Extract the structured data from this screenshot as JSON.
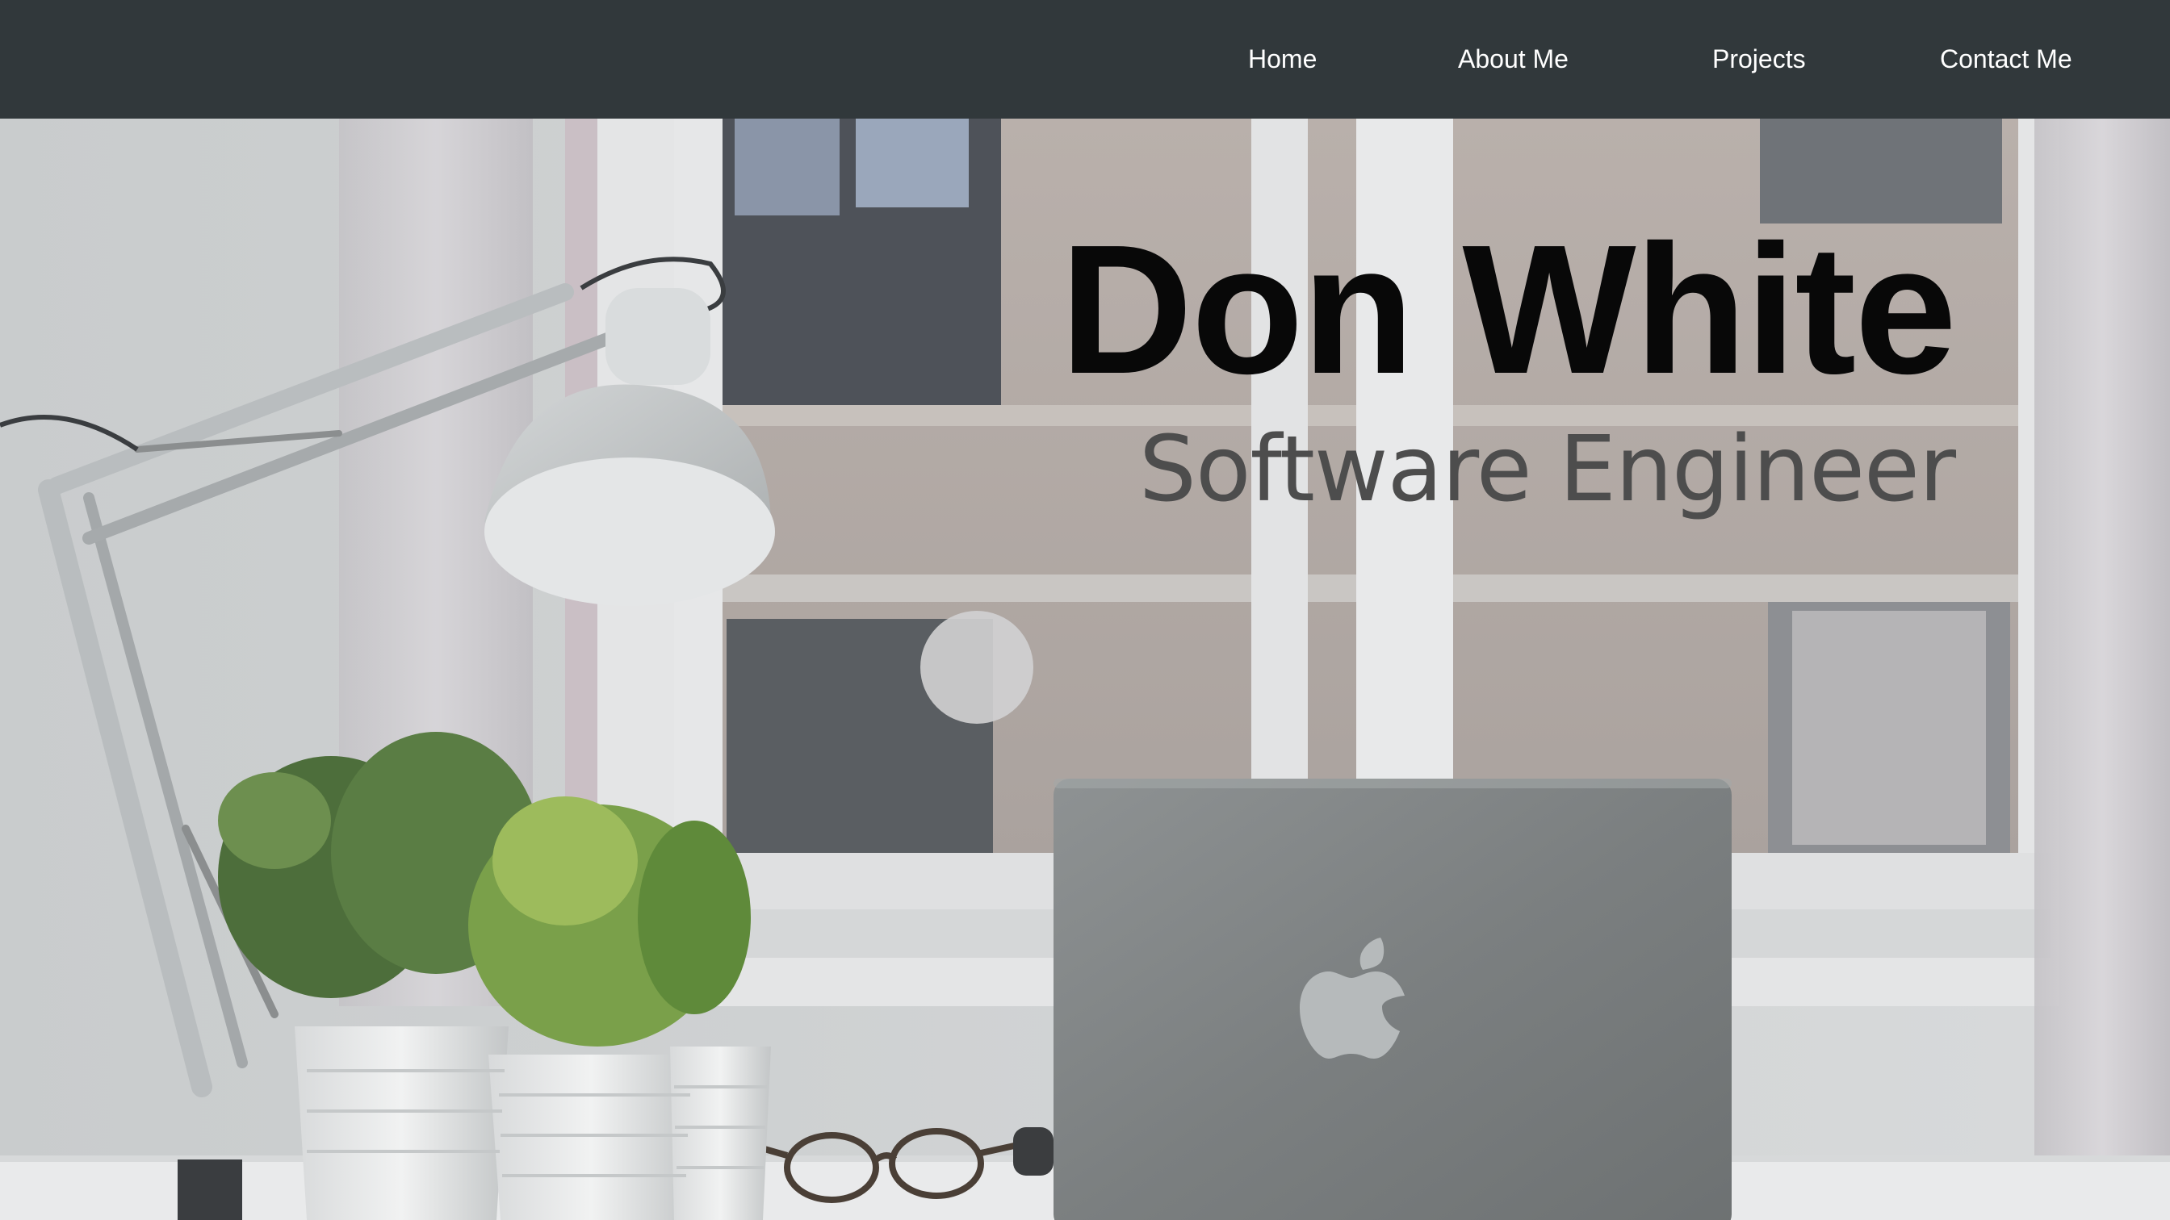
{
  "nav": {
    "items": [
      {
        "label": "Home"
      },
      {
        "label": "About Me"
      },
      {
        "label": "Projects"
      },
      {
        "label": "Contact Me"
      }
    ]
  },
  "hero": {
    "title": "Don White",
    "subtitle": "Software Engineer",
    "background_image": "desk-workspace-photo",
    "icons": [
      "apple-logo-icon"
    ]
  },
  "colors": {
    "navbar": "#31383b",
    "nav_text": "#ffffff",
    "title": "#080808",
    "subtitle": "#4d4d4d"
  }
}
